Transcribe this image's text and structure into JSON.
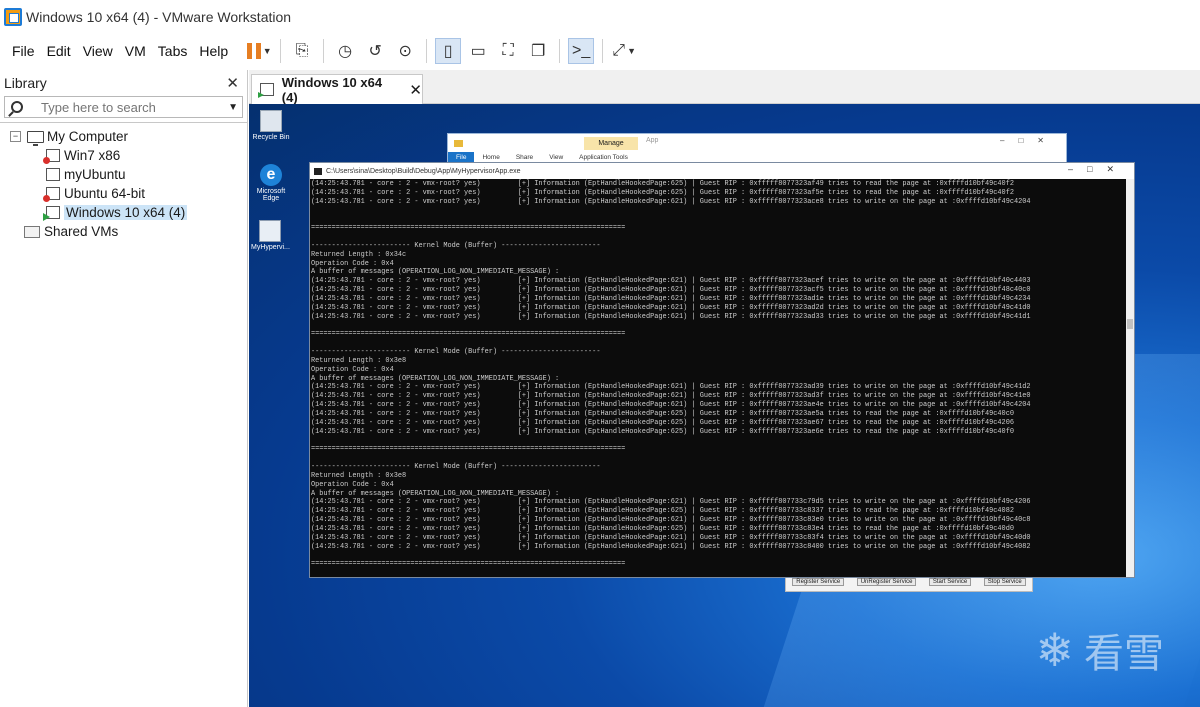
{
  "window": {
    "title": "Windows 10 x64 (4) - VMware Workstation"
  },
  "menu": [
    "File",
    "Edit",
    "View",
    "VM",
    "Tabs",
    "Help"
  ],
  "library": {
    "title": "Library",
    "search_placeholder": "Type here to search",
    "root": "My Computer",
    "vms": [
      {
        "name": "Win7 x86",
        "state": "error"
      },
      {
        "name": "myUbuntu",
        "state": "off"
      },
      {
        "name": "Ubuntu 64-bit",
        "state": "error"
      },
      {
        "name": "Windows 10 x64 (4)",
        "state": "running",
        "selected": true
      }
    ],
    "shared": "Shared VMs"
  },
  "tab": {
    "label": "Windows 10 x64 (4)"
  },
  "desktop": {
    "icons": [
      "Recycle Bin",
      "Microsoft Edge",
      "MyHypervi..."
    ],
    "explorer": {
      "manage": "Manage",
      "app": "App",
      "ribbon": [
        "File",
        "Home",
        "Share",
        "View",
        "Application Tools"
      ]
    },
    "service_buttons": [
      "Register Service",
      "UnRegister Service",
      "Start Service",
      "Stop Service"
    ],
    "watermark": "看雪"
  },
  "console": {
    "title": "C:\\Users\\sina\\Desktop\\Build\\Debug\\App\\MyHypervisorApp.exe",
    "lines": [
      "(14:25:43.781 - core : 2 - vmx-root? yes)         [+] Information (EptHandleHookedPage:625) | Guest RIP : 0xfffff8077323af49 tries to read the page at :0xffffd10bf49c40f2",
      "(14:25:43.781 - core : 2 - vmx-root? yes)         [+] Information (EptHandleHookedPage:625) | Guest RIP : 0xfffff8077323af5e tries to read the page at :0xffffd10bf49c40f2",
      "(14:25:43.781 - core : 2 - vmx-root? yes)         [+] Information (EptHandleHookedPage:621) | Guest RIP : 0xfffff8077323ace8 tries to write on the page at :0xffffd10bf49c4204",
      "",
      "",
      "============================================================================",
      "",
      "------------------------ Kernel Mode (Buffer) ------------------------",
      "Returned Length : 0x34c",
      "Operation Code : 0x4",
      "A buffer of messages (OPERATION_LOG_NON_IMMEDIATE_MESSAGE) :",
      "(14:25:43.781 - core : 2 - vmx-root? yes)         [+] Information (EptHandleHookedPage:621) | Guest RIP : 0xfffff8077323acef tries to write on the page at :0xffffd10bf40c4403",
      "(14:25:43.781 - core : 2 - vmx-root? yes)         [+] Information (EptHandleHookedPage:621) | Guest RIP : 0xfffff8077323acf5 tries to write on the page at :0xffffd10bf48c40c0",
      "(14:25:43.781 - core : 2 - vmx-root? yes)         [+] Information (EptHandleHookedPage:621) | Guest RIP : 0xfffff8077323ad1e tries to write on the page at :0xffffd10bf49c4234",
      "(14:25:43.781 - core : 2 - vmx-root? yes)         [+] Information (EptHandleHookedPage:621) | Guest RIP : 0xfffff8077323ad2d tries to write on the page at :0xffffd10bf49c41d0",
      "(14:25:43.781 - core : 2 - vmx-root? yes)         [+] Information (EptHandleHookedPage:621) | Guest RIP : 0xfffff8077323ad33 tries to write on the page at :0xffffd10bf49c41d1",
      "",
      "============================================================================",
      "",
      "------------------------ Kernel Mode (Buffer) ------------------------",
      "Returned Length : 0x3e8",
      "Operation Code : 0x4",
      "A buffer of messages (OPERATION_LOG_NON_IMMEDIATE_MESSAGE) :",
      "(14:25:43.781 - core : 2 - vmx-root? yes)         [+] Information (EptHandleHookedPage:621) | Guest RIP : 0xfffff8077323ad39 tries to write on the page at :0xffffd10bf49c41d2",
      "(14:25:43.781 - core : 2 - vmx-root? yes)         [+] Information (EptHandleHookedPage:621) | Guest RIP : 0xfffff8077323ad3f tries to write on the page at :0xffffd10bf49c41e0",
      "(14:25:43.781 - core : 2 - vmx-root? yes)         [+] Information (EptHandleHookedPage:621) | Guest RIP : 0xfffff8077323ae4e tries to write on the page at :0xffffd10bf49c4204",
      "(14:25:43.781 - core : 2 - vmx-root? yes)         [+] Information (EptHandleHookedPage:625) | Guest RIP : 0xfffff8077323ae5a tries to read the page at :0xffffd10bf49c40c0",
      "(14:25:43.781 - core : 2 - vmx-root? yes)         [+] Information (EptHandleHookedPage:625) | Guest RIP : 0xfffff8077323ae67 tries to read the page at :0xffffd10bf49c4206",
      "(14:25:43.781 - core : 2 - vmx-root? yes)         [+] Information (EptHandleHookedPage:625) | Guest RIP : 0xfffff8077323ae6e tries to read the page at :0xffffd10bf49c40f0",
      "",
      "============================================================================",
      "",
      "------------------------ Kernel Mode (Buffer) ------------------------",
      "Returned Length : 0x3e8",
      "Operation Code : 0x4",
      "A buffer of messages (OPERATION_LOG_NON_IMMEDIATE_MESSAGE) :",
      "(14:25:43.781 - core : 2 - vmx-root? yes)         [+] Information (EptHandleHookedPage:621) | Guest RIP : 0xfffff807733c79d5 tries to write on the page at :0xffffd10bf49c4206",
      "(14:25:43.781 - core : 2 - vmx-root? yes)         [+] Information (EptHandleHookedPage:625) | Guest RIP : 0xfffff807733c8337 tries to read the page at :0xffffd10bf49c4082",
      "(14:25:43.781 - core : 2 - vmx-root? yes)         [+] Information (EptHandleHookedPage:621) | Guest RIP : 0xfffff807733c83e0 tries to write on the page at :0xffffd10bf49c40c8",
      "(14:25:43.781 - core : 2 - vmx-root? yes)         [+] Information (EptHandleHookedPage:625) | Guest RIP : 0xfffff807733c83e4 tries to read the page at :0xffffd10bf49c40d0",
      "(14:25:43.781 - core : 2 - vmx-root? yes)         [+] Information (EptHandleHookedPage:621) | Guest RIP : 0xfffff807733c83f4 tries to write on the page at :0xffffd10bf49c40d0",
      "(14:25:43.781 - core : 2 - vmx-root? yes)         [+] Information (EptHandleHookedPage:621) | Guest RIP : 0xfffff807733c8400 tries to write on the page at :0xffffd10bf49c4082",
      "",
      "============================================================================"
    ]
  }
}
